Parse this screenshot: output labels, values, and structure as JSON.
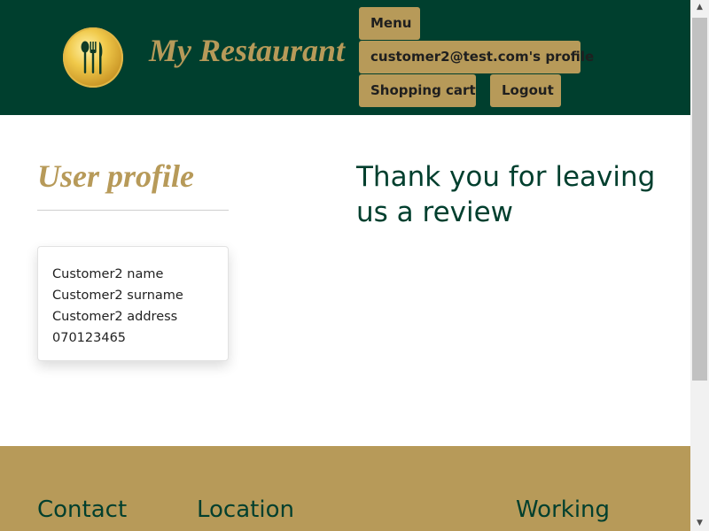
{
  "header": {
    "brand": "My Restaurant",
    "logo_icon": "fork-spoon-knife-icon",
    "nav": {
      "menu": "Menu",
      "profile": "customer2@test.com's profile",
      "cart": "Shopping cart",
      "logout": "Logout"
    }
  },
  "profile": {
    "title": "User profile",
    "name": "Customer2 name",
    "surname": "Customer2 surname",
    "address": "Customer2 address",
    "phone": "070123465"
  },
  "message": "Thank you for leaving us a review",
  "footer": {
    "headings": [
      "Contact",
      "Location",
      "Working hours"
    ]
  },
  "colors": {
    "header_bg": "#003f2e",
    "accent_gold": "#b79a59",
    "footer_bg": "#b79a59"
  }
}
